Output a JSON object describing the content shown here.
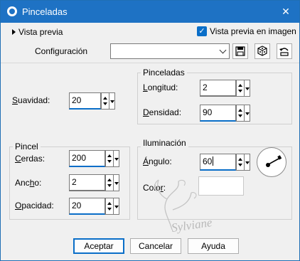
{
  "window": {
    "title": "Pinceladas",
    "close_symbol": "✕"
  },
  "preview": {
    "toggle_label": "Vista previa",
    "checkbox_label": "Vista previa en imagen",
    "checkbox_checked": true
  },
  "config": {
    "label": "Configuración",
    "value": ""
  },
  "suavidad": {
    "label_u": "S",
    "label_rest": "uavidad:",
    "value": "20"
  },
  "pinceladas_group": {
    "title": "Pinceladas",
    "longitud": {
      "label_u": "L",
      "label_rest": "ongitud:",
      "value": "2"
    },
    "densidad": {
      "label_u": "D",
      "label_rest": "ensidad:",
      "value": "90"
    }
  },
  "pincel_group": {
    "title": "Pincel",
    "cerdas": {
      "label_u": "C",
      "label_rest": "erdas:",
      "value": "200"
    },
    "ancho": {
      "label_pre": "Anc",
      "label_u": "h",
      "label_rest": "o:",
      "value": "2"
    },
    "opacidad": {
      "label_u": "O",
      "label_rest": "pacidad:",
      "value": "20"
    }
  },
  "iluminacion_group": {
    "title": "Iluminación",
    "angulo": {
      "label_u": "Á",
      "label_rest": "ngulo:",
      "value": "60"
    },
    "color": {
      "label_pre": "Colo",
      "label_u": "r",
      "label_rest": ":",
      "swatch": "#ffffff"
    }
  },
  "buttons": {
    "accept": "Aceptar",
    "cancel": "Cancelar",
    "help": "Ayuda"
  },
  "watermark": {
    "text": "Sylviane"
  },
  "colors": {
    "title_bar": "#1e72c4",
    "accent": "#0a6ec8",
    "background": "#f0f0f0"
  }
}
